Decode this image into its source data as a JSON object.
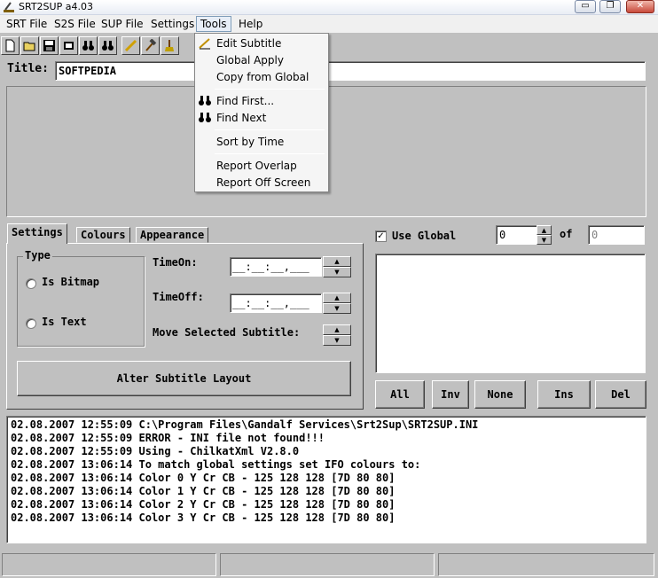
{
  "window": {
    "title": "SRT2SUP a4.03",
    "minimize": "▭",
    "maximize": "❐",
    "close": "✕"
  },
  "menubar": [
    "SRT File",
    "S2S File",
    "SUP File",
    "Settings",
    "Tools",
    "Help"
  ],
  "toolbar": {
    "icons": [
      "new-file-icon",
      "open-folder-icon",
      "save-disk-icon",
      "film-reel-icon",
      "binoculars-icon",
      "pencil-icon",
      "hammer-icon",
      "broom-icon"
    ]
  },
  "tools_menu": {
    "items": [
      "Edit Subtitle",
      "Global Apply",
      "Copy from Global",
      "Find First...",
      "Find Next",
      "Sort by Time",
      "Report Overlap",
      "Report Off Screen"
    ]
  },
  "title_row": {
    "label": "Title:",
    "value": "SOFTPEDIA"
  },
  "tabs": [
    "Settings",
    "Colours",
    "Appearance"
  ],
  "settings": {
    "type_group": "Type",
    "is_bitmap": "Is Bitmap",
    "is_text": "Is Text",
    "time_on_label": "TimeOn:",
    "time_on_value": "__:__:__,___",
    "time_off_label": "TimeOff:",
    "time_off_value": "__:__:__,___",
    "move_label": "Move Selected Subtitle:",
    "alter_button": "Alter Subtitle Layout"
  },
  "global": {
    "checkbox_mark": "✓",
    "label": "Use Global",
    "index_value": "0",
    "of_label": "of",
    "total_value": "0"
  },
  "buttons": {
    "all": "All",
    "inv": "Inv",
    "none": "None",
    "ins": "Ins",
    "del": "Del"
  },
  "log": [
    "02.08.2007 12:55:09 C:\\Program Files\\Gandalf Services\\Srt2Sup\\SRT2SUP.INI",
    "02.08.2007 12:55:09 ERROR - INI file not found!!!",
    "02.08.2007 12:55:09 Using - ChilkatXml V2.8.0",
    "02.08.2007 13:06:14 To match global settings set IFO colours to:",
    "02.08.2007 13:06:14 Color 0 Y Cr CB - 125 128 128 [7D 80 80]",
    "02.08.2007 13:06:14 Color 1 Y Cr CB - 125 128 128 [7D 80 80]",
    "02.08.2007 13:06:14 Color 2 Y Cr CB - 125 128 128 [7D 80 80]",
    "02.08.2007 13:06:14 Color 3 Y Cr CB - 125 128 128 [7D 80 80]"
  ]
}
